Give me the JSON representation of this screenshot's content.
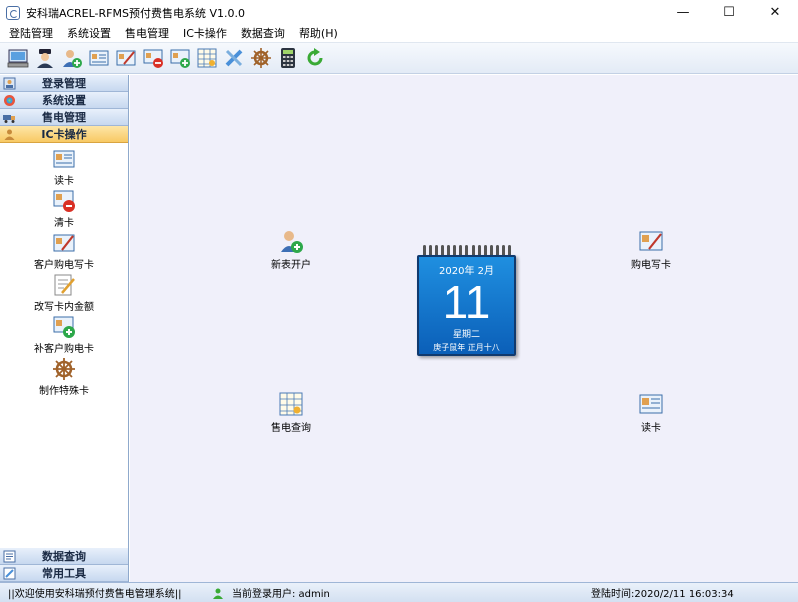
{
  "window": {
    "title": "安科瑞ACREL-RFMS预付费售电系统 V1.0.0",
    "minimize": "—",
    "maximize": "☐",
    "close": "✕"
  },
  "menu": [
    "登陆管理",
    "系统设置",
    "售电管理",
    "IC卡操作",
    "数据查询",
    "帮助(H)"
  ],
  "toolbar": [
    {
      "icon": "computer-icon"
    },
    {
      "icon": "police-icon"
    },
    {
      "icon": "add-user-icon"
    },
    {
      "icon": "read-card-icon"
    },
    {
      "icon": "write-card-icon"
    },
    {
      "icon": "clear-card-icon"
    },
    {
      "icon": "add-card-icon"
    },
    {
      "icon": "table-query-icon"
    },
    {
      "icon": "tools-icon"
    },
    {
      "icon": "helm-icon"
    },
    {
      "icon": "calculator-icon"
    },
    {
      "icon": "refresh-icon"
    }
  ],
  "sidebar": {
    "groups": [
      {
        "label": "登录管理",
        "icon": "login-icon"
      },
      {
        "label": "系统设置",
        "icon": "settings-icon"
      },
      {
        "label": "售电管理",
        "icon": "truck-icon"
      },
      {
        "label": "IC卡操作",
        "icon": "user-icon"
      }
    ],
    "items": [
      {
        "label": "读卡",
        "icon": "read-card-icon"
      },
      {
        "label": "清卡",
        "icon": "clear-card-icon"
      },
      {
        "label": "客户购电写卡",
        "icon": "write-card-icon"
      },
      {
        "label": "改写卡内金额",
        "icon": "edit-amount-icon"
      },
      {
        "label": "补客户购电卡",
        "icon": "add-card-icon"
      },
      {
        "label": "制作特殊卡",
        "icon": "helm-icon"
      }
    ],
    "bottom_groups": [
      {
        "label": "数据查询",
        "icon": "data-query-icon"
      },
      {
        "label": "常用工具",
        "icon": "tools-icon"
      }
    ]
  },
  "shortcuts": {
    "new_account": "新表开户",
    "buy_write_card": "购电写卡",
    "sales_query": "售电查询",
    "read_card": "读卡"
  },
  "calendar": {
    "year_month": "2020年  2月",
    "day": "11",
    "weekday": "星期二",
    "lunar": "庚子鼠年  正月十八"
  },
  "status": {
    "welcome": "||欢迎使用安科瑞预付费售电管理系统||",
    "current_user": "当前登录用户: admin",
    "login_time": "登陆时间:2020/2/11 16:03:34"
  },
  "colors": {
    "accent": "#0b5fb8",
    "active_group": "#f8c964",
    "workspace": "#f0f0fa"
  }
}
